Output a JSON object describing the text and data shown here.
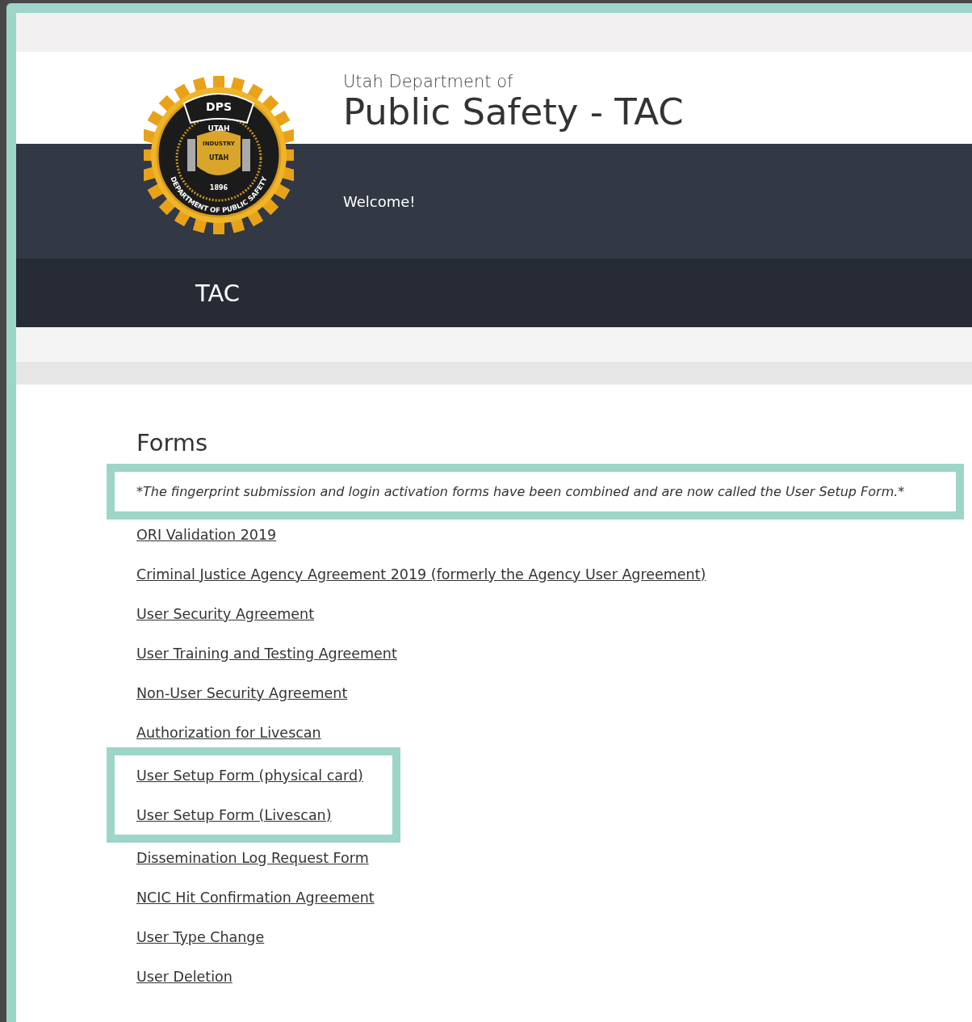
{
  "header": {
    "subtitle": "Utah Department of",
    "title": "Public Safety - TAC",
    "welcome": "Welcome!"
  },
  "logo": {
    "banner": "DPS",
    "state": "UTAH",
    "ring": "DEPARTMENT OF PUBLIC SAFETY",
    "motto": "INDUSTRY",
    "shield": "UTAH",
    "year": "1896"
  },
  "nav": {
    "items": [
      {
        "label": "TAC"
      }
    ]
  },
  "forms": {
    "heading": "Forms",
    "sections": [
      {
        "framed": true,
        "items": [
          {
            "kind": "note",
            "text": "*The fingerprint submission and login activation forms have been combined and are now called the User Setup Form.*"
          }
        ]
      },
      {
        "framed": false,
        "items": [
          {
            "kind": "link",
            "text": "ORI Validation 2019"
          },
          {
            "kind": "link",
            "text": "Criminal Justice Agency Agreement 2019 (formerly the Agency User Agreement)"
          },
          {
            "kind": "link",
            "text": "User Security Agreement"
          },
          {
            "kind": "link",
            "text": "User Training and Testing Agreement"
          },
          {
            "kind": "link",
            "text": "Non-User Security Agreement"
          },
          {
            "kind": "link",
            "text": "Authorization for Livescan"
          }
        ]
      },
      {
        "framed": true,
        "items": [
          {
            "kind": "link",
            "text": "User Setup Form (physical card)"
          },
          {
            "kind": "link",
            "text": "User Setup Form (Livescan)"
          }
        ]
      },
      {
        "framed": false,
        "items": [
          {
            "kind": "link",
            "text": "Dissemination Log Request Form"
          },
          {
            "kind": "link",
            "text": "NCIC Hit Confirmation Agreement"
          },
          {
            "kind": "link",
            "text": "User Type Change"
          },
          {
            "kind": "link",
            "text": "User Deletion"
          }
        ]
      }
    ]
  }
}
